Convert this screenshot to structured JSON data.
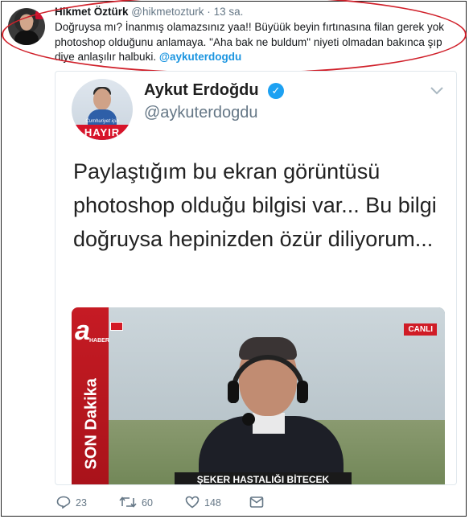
{
  "tweet": {
    "author_name": "Hikmet Öztürk",
    "author_handle": "@hikmetozturk",
    "separator": "·",
    "time": "13 sa.",
    "text": "Doğruysa mı? İnanmış olamazsınız yaa!! Büyüük beyin fırtınasına filan gerek yok photoshop olduğunu anlamaya. \"Aha bak ne buldum\" niyeti olmadan bakınca şıp diye anlaşılır halbuki.",
    "mention": "@aykuterdogdu"
  },
  "quoted_tweet": {
    "author_name": "Aykut Erdoğdu",
    "author_handle": "@aykuterdogdu",
    "verified_glyph": "✓",
    "avatar_caption": "Cumhuriyet için",
    "avatar_label": "HAYIR",
    "text": "Paylaştığım bu ekran görüntüsü photoshop olduğu bilgisi var... Bu bilgi doğruysa hepinizden özür diliyorum...",
    "image": {
      "channel_logo": "a",
      "channel_sub": "HABER",
      "live_badge": "CANLI",
      "side_banner": "SON Dakika",
      "ticker": "ŞEKER HASTALIĞI BİTECEK"
    }
  },
  "actions": {
    "reply_count": "23",
    "retweet_count": "60",
    "like_count": "148"
  },
  "icons": {
    "reply": "reply-icon",
    "retweet": "retweet-icon",
    "like": "heart-icon",
    "message": "message-icon",
    "verified": "verified-badge-icon",
    "more": "chevron-down-icon"
  },
  "colors": {
    "link": "#1b95e0",
    "verified": "#1da1f2",
    "highlight_oval": "#d0202a",
    "muted": "#657786"
  }
}
